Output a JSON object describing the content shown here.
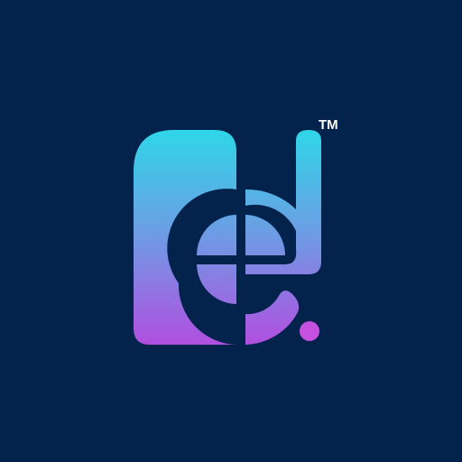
{
  "logo": {
    "trademark": "TM",
    "colors": {
      "background": "#03234d",
      "gradient_top": "#2fd6e8",
      "gradient_bottom": "#b14fe0",
      "dot": "#c651e0"
    },
    "icon": "ed-monogram-logo"
  }
}
